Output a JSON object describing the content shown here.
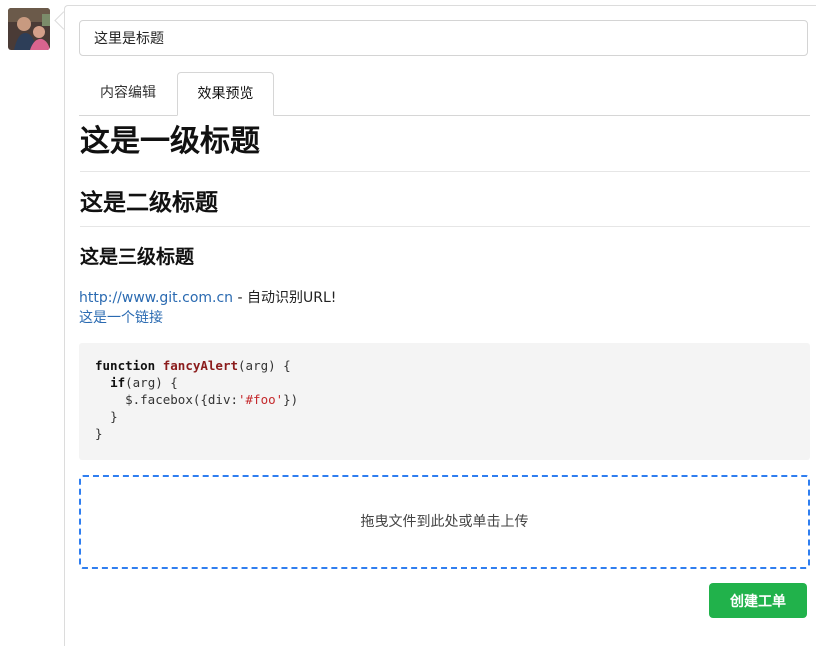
{
  "title_input": {
    "value": "这里是标题"
  },
  "tabs": [
    {
      "label": "内容编辑",
      "active": false
    },
    {
      "label": "效果预览",
      "active": true
    }
  ],
  "preview": {
    "h1": "这是一级标题",
    "h2": "这是二级标题",
    "h3": "这是三级标题",
    "auto_url": "http://www.git.com.cn",
    "auto_url_suffix": " - 自动识别URL!",
    "link_text": "这是一个链接",
    "code": {
      "line1_kw": "function",
      "line1_fn": "fancyAlert",
      "line1_rest": "(arg) {",
      "line2_kw": "if",
      "line2_rest": "(arg) {",
      "line3_pre": "$.facebox({div:",
      "line3_str": "'#foo'",
      "line3_post": "})",
      "line4": "}",
      "line5": "}"
    }
  },
  "dropzone": {
    "label": "拖曳文件到此处或单击上传"
  },
  "submit_button": {
    "label": "创建工单",
    "color": "#21b24b"
  },
  "colors": {
    "link": "#2a6ab1",
    "dropzone_border": "#2f7ef0"
  }
}
